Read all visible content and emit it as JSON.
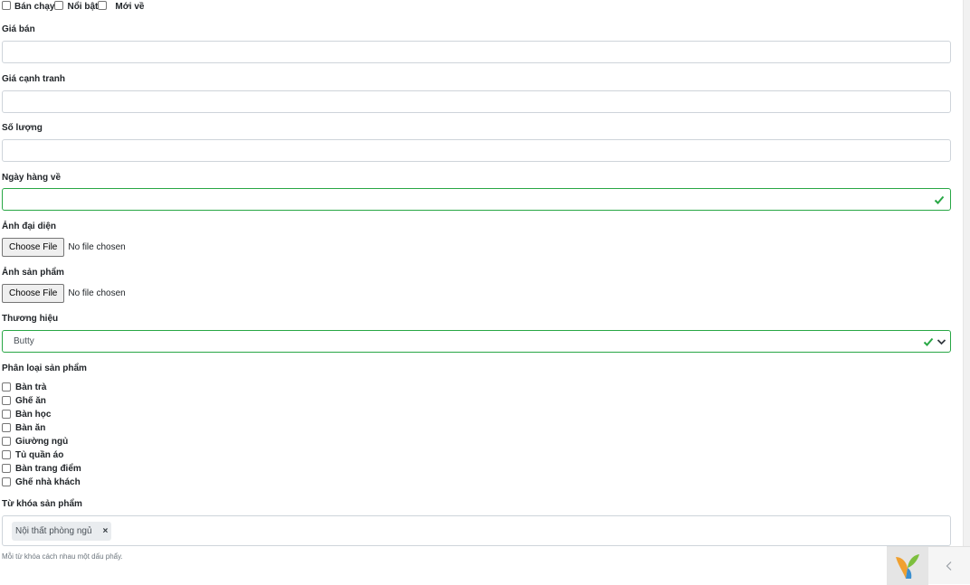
{
  "flags": {
    "items": [
      {
        "label": "Bán chạy",
        "checked": false
      },
      {
        "label": "Nổi bật",
        "checked": false
      },
      {
        "label": "Mới về",
        "checked": false
      }
    ]
  },
  "fields": {
    "sale_price": {
      "label": "Giá bán",
      "value": ""
    },
    "compare_price": {
      "label": "Giá cạnh tranh",
      "value": ""
    },
    "quantity": {
      "label": "Số lượng",
      "value": ""
    },
    "arrival_date": {
      "label": "Ngày hàng về",
      "value": "",
      "state": "valid"
    },
    "avatar_image": {
      "label": "Ảnh đại diện",
      "button": "Choose File",
      "status": "No file chosen"
    },
    "product_images": {
      "label": "Ảnh sản phẩm",
      "button": "Choose File",
      "status": "No file chosen"
    },
    "brand": {
      "label": "Thương hiệu",
      "selected": "Butty",
      "state": "valid"
    }
  },
  "categories": {
    "label": "Phân loại sản phẩm",
    "items": [
      {
        "label": "Bàn trà",
        "checked": false
      },
      {
        "label": "Ghế ăn",
        "checked": false
      },
      {
        "label": "Bàn học",
        "checked": false
      },
      {
        "label": "Bàn ăn",
        "checked": false
      },
      {
        "label": "Giường ngủ",
        "checked": false
      },
      {
        "label": "Tủ quần áo",
        "checked": false
      },
      {
        "label": "Bàn trang điểm",
        "checked": false
      },
      {
        "label": "Ghế nhà khách",
        "checked": false
      }
    ]
  },
  "keywords": {
    "label": "Từ khóa sản phẩm",
    "tags": [
      {
        "text": "Nội thất phòng ngủ",
        "remove": "×"
      }
    ],
    "hint": "Mỗi từ khóa cách nhau một dấu phẩy."
  },
  "colors": {
    "valid": "#28a745",
    "border": "#ced4da"
  },
  "icons": {
    "valid": "check-icon",
    "dropdown": "chevron-down-icon",
    "debug_logo": "yii-logo-icon",
    "debug_toggle": "chevron-left-icon"
  }
}
